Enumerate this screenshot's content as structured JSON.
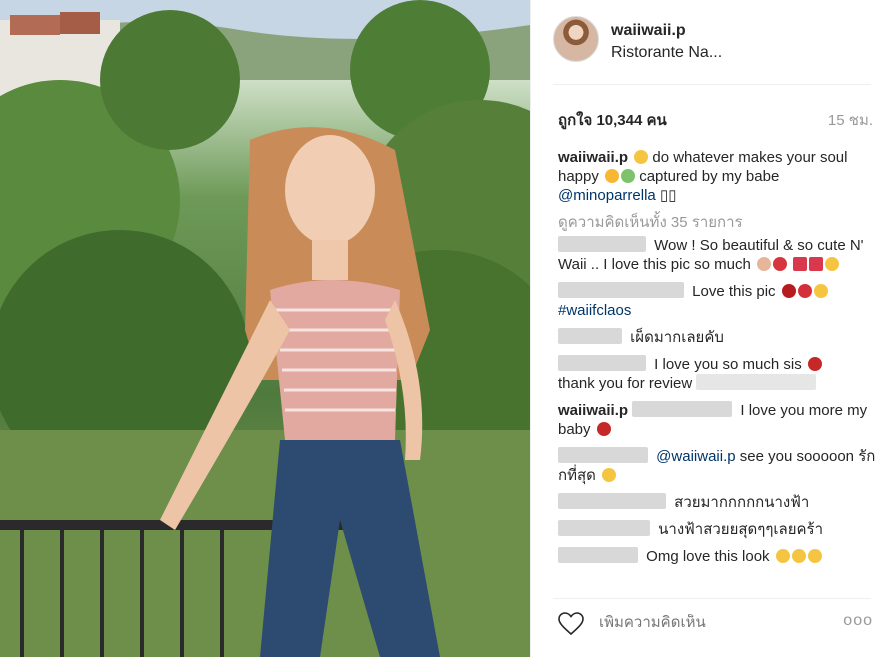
{
  "post": {
    "username": "waiiwaii.p",
    "location": "Ristorante Na...",
    "likes_text": "ถูกใจ 10,344 คน",
    "time_ago": "15 ชม."
  },
  "caption": {
    "username": "waiiwaii.p",
    "text_part1": "do whatever makes your soul happy",
    "text_part2": "captured by my babe",
    "mention": "@minoparrella",
    "trailing": "▯▯"
  },
  "view_all": "ดูความคิดเห็นทั้ง 35 รายการ",
  "comments": [
    {
      "text": "Wow ! So beautiful & so cute N' Waii .. I love this pic so much"
    },
    {
      "text": "Love this pic",
      "tag": "#waiifclaos"
    },
    {
      "text": "เผ็ดมากเลยคับ"
    },
    {
      "text": "I love you so much sis",
      "text2": "thank you for review"
    },
    {
      "user": "waiiwaii.p",
      "text": "I love you more my baby"
    },
    {
      "mention": "@waiiwaii.p",
      "text": "see you sooooon รักกที่สุด"
    },
    {
      "text": "สวยมากกกกกนางฟ้า"
    },
    {
      "text": "นางฟ้าสวยยสุดๆๆเลยคร้า"
    },
    {
      "text": "Omg love this look"
    }
  ],
  "footer": {
    "add_comment_placeholder": "เพิ่มความคิดเห็น",
    "more_label": "ooo"
  },
  "colors": {
    "link": "#003569",
    "muted": "#999999",
    "text": "#262626"
  },
  "icons": {
    "like": "heart-outline-icon",
    "options": "more-options-icon"
  }
}
